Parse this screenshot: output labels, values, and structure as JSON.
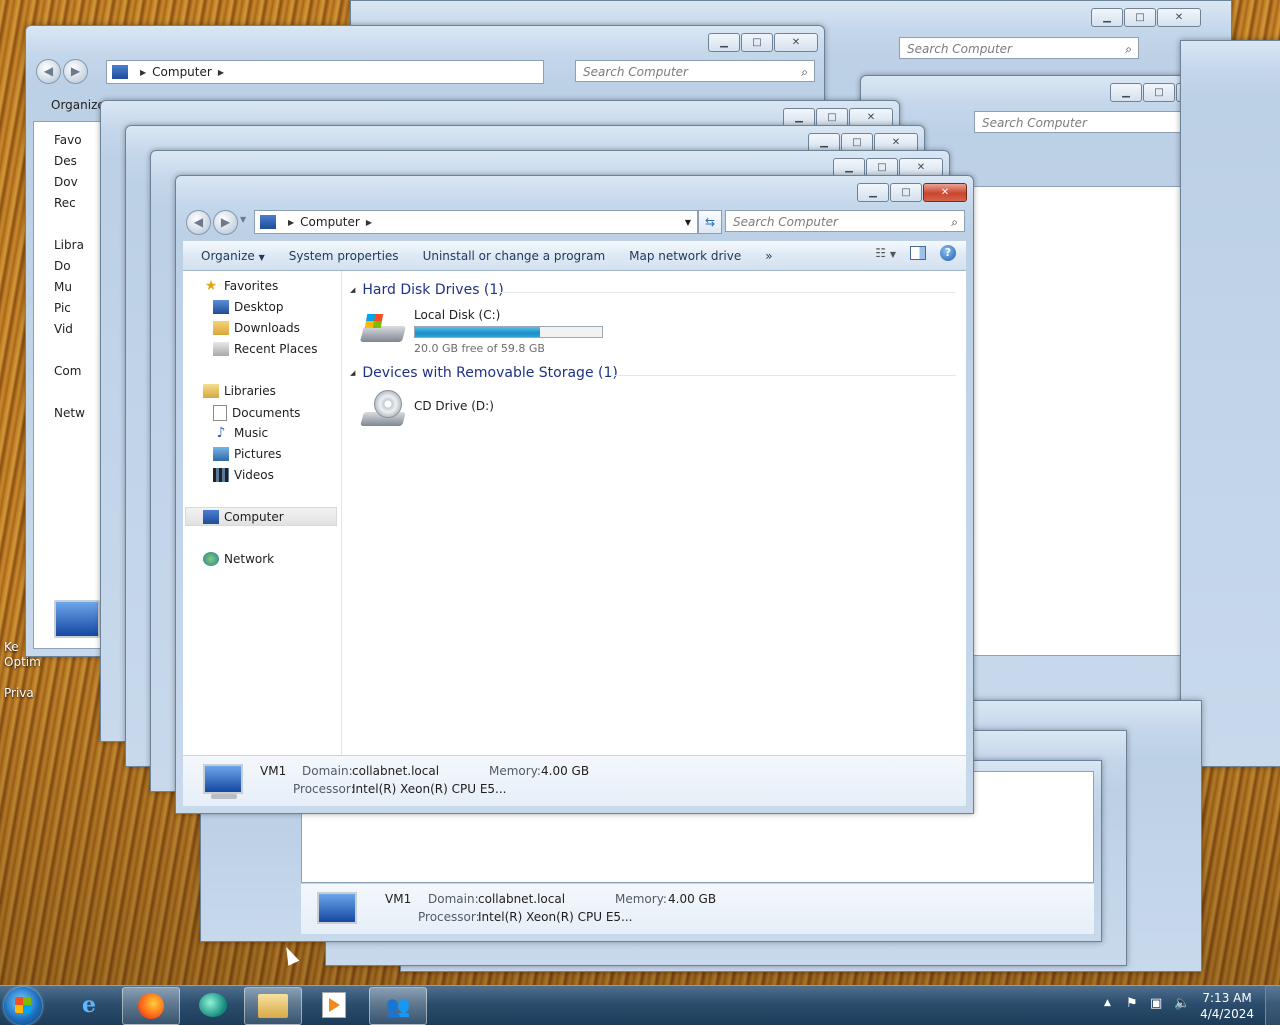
{
  "desktop": {
    "icon_labels": [
      "Ke",
      "Optim",
      "Priva"
    ]
  },
  "background_windows": [
    {
      "search_placeholder": "Search Computer",
      "address": "Computer",
      "organize": "Organize",
      "nav_fragments": [
        "Favo",
        "Des",
        "Dov",
        "Rec",
        "Libra",
        "Do",
        "Mu",
        "Pic",
        "Vid",
        "Com",
        "Netw"
      ]
    },
    {
      "search_placeholder": "Search Computer"
    },
    {
      "search_placeholder": "Search Computer"
    }
  ],
  "window": {
    "address": {
      "location": "Computer"
    },
    "search": {
      "placeholder": "Search Computer"
    },
    "toolbar": {
      "organize": "Organize",
      "system_properties": "System properties",
      "uninstall": "Uninstall or change a program",
      "map_drive": "Map network drive",
      "more": "»"
    },
    "nav": {
      "favorites": "Favorites",
      "desktop": "Desktop",
      "downloads": "Downloads",
      "recent_places": "Recent Places",
      "libraries": "Libraries",
      "documents": "Documents",
      "music": "Music",
      "pictures": "Pictures",
      "videos": "Videos",
      "computer": "Computer",
      "network": "Network"
    },
    "groups": {
      "hdd": "Hard Disk Drives (1)",
      "removable": "Devices with Removable Storage (1)"
    },
    "drives": {
      "c": {
        "name": "Local Disk (C:)",
        "free_text": "20.0 GB free of 59.8 GB",
        "used_fraction": 0.666
      },
      "d": {
        "name": "CD Drive (D:)"
      }
    },
    "details": {
      "computer_name": "VM1",
      "domain_label": "Domain:",
      "domain_value": "collabnet.local",
      "memory_label": "Memory:",
      "memory_value": "4.00 GB",
      "processor_label": "Processor:",
      "processor_value": "Intel(R) Xeon(R) CPU E5..."
    }
  },
  "lower_window": {
    "details": {
      "computer_name": "VM1",
      "domain_label": "Domain:",
      "domain_value": "collabnet.local",
      "memory_label": "Memory:",
      "memory_value": "4.00 GB",
      "processor_label": "Processor:",
      "processor_value": "Intel(R) Xeon(R) CPU E5..."
    }
  },
  "taskbar": {
    "apps": [
      "internet-explorer",
      "firefox",
      "chat-app",
      "windows-explorer",
      "media-player",
      "network-users"
    ],
    "clock": {
      "time": "7:13 AM",
      "date": "4/4/2024"
    }
  },
  "colors": {
    "accent": "#1e3287",
    "progress": "#1a8ec6",
    "close_button": "#c9462c"
  }
}
